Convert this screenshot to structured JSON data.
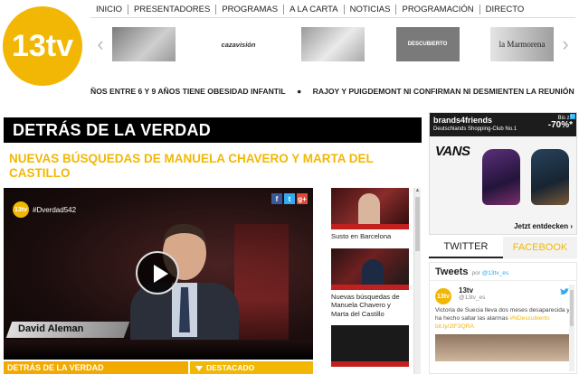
{
  "site": {
    "logo_text": "13tv",
    "brand_color": "#f2b705"
  },
  "nav": {
    "items": [
      "INICIO",
      "PRESENTADORES",
      "PROGRAMAS",
      "A LA CARTA",
      "NOTICIAS",
      "PROGRAMACIÓN",
      "DIRECTO"
    ]
  },
  "carousel": {
    "prev_icon": "chevron-left-icon",
    "next_icon": "chevron-right-icon",
    "shows": [
      "",
      "cazavisión",
      "",
      "DESCUBIERTO",
      "la Marmorena"
    ]
  },
  "ticker": {
    "item1": "ÑOS ENTRE 6 Y 9 AÑOS TIENE OBESIDAD INFANTIL",
    "separator": "●",
    "item2": "RAJOY Y PUIGDEMONT NI CONFIRMAN NI DESMIENTEN LA REUNIÓN MANTENIDA EN MO"
  },
  "section_title": "DETRÁS DE LA VERDAD",
  "headline": "NUEVAS BÚSQUEDAS DE MANUELA CHAVERO Y MARTA DEL CASTILLO",
  "video": {
    "hashtag": "#Dverdad542",
    "channel_badge": "13tv",
    "presenter_name": "David Aleman",
    "social": [
      "f",
      "t",
      "g+"
    ]
  },
  "bottom_bar": {
    "left_label": "DETRÁS DE LA VERDAD",
    "right_label": "DESTACADO"
  },
  "related": [
    {
      "caption": "Susto en Barcelona"
    },
    {
      "caption": "Nuevas búsquedas de Manuela Chavero y Marta del Castillo"
    },
    {
      "caption": ""
    }
  ],
  "ad": {
    "brand": "brands4friends",
    "sub": "Deutschlands Shopping-Club No.1",
    "price_label": "Bis zu",
    "discount": "-70%*",
    "logo": "VANS",
    "cta": "Jetzt entdecken ›",
    "info": "▷"
  },
  "social_tabs": {
    "twitter": "TWITTER",
    "facebook": "FACEBOOK"
  },
  "tweets": {
    "title": "Tweets",
    "by": "por",
    "handle": "@13tv_es",
    "tweet": {
      "user": "13tv",
      "handle": "@13tv_es",
      "text": "Victoria de Suecia lleva dos meses desaparecida y ha hecho saltar las alarmas",
      "hashtag": "#NDescubierto",
      "link": "bit.ly/2tF3QRA"
    }
  }
}
